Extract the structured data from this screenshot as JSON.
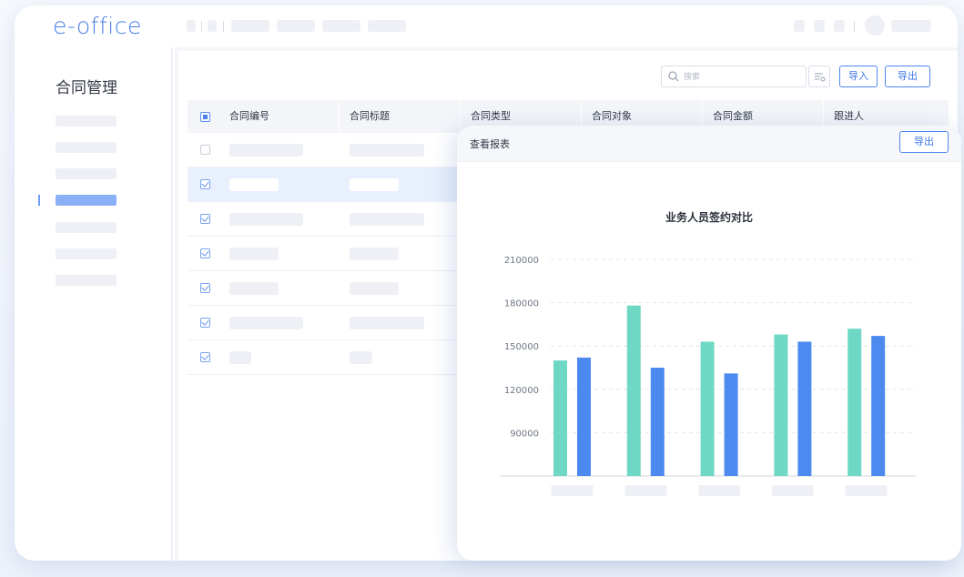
{
  "app": {
    "logo_text": "e-office"
  },
  "sidebar": {
    "title": "合同管理"
  },
  "toolbar": {
    "search_placeholder": "搜索",
    "import_label": "导入",
    "export_label": "导出"
  },
  "table": {
    "columns": [
      "合同编号",
      "合同标题",
      "合同类型",
      "合同对象",
      "合同金额",
      "跟进人"
    ],
    "rows": [
      {
        "checked": false,
        "selected": false
      },
      {
        "checked": true,
        "selected": true
      },
      {
        "checked": true,
        "selected": false
      },
      {
        "checked": true,
        "selected": false
      },
      {
        "checked": true,
        "selected": false
      },
      {
        "checked": true,
        "selected": false
      },
      {
        "checked": true,
        "selected": false
      }
    ]
  },
  "report": {
    "panel_title": "查看报表",
    "export_label": "导出"
  },
  "chart_data": {
    "type": "bar",
    "title": "业务人员签约对比",
    "y_ticks": [
      "210000",
      "180000",
      "150000",
      "120000",
      "90000"
    ],
    "ylim": [
      60000,
      210000
    ],
    "grid": true,
    "categories": [
      "",
      "",
      "",
      "",
      ""
    ],
    "series": [
      {
        "color": "#6fd8c4",
        "values": [
          140000,
          178000,
          153000,
          158000,
          162000
        ]
      },
      {
        "color": "#4d8af0",
        "values": [
          142000,
          135000,
          131000,
          153000,
          157000
        ]
      }
    ]
  },
  "colors": {
    "accent": "#4a7fe6",
    "teal": "#6fd8c4",
    "blue": "#4d8af0"
  },
  "icons": {
    "search": "search-icon",
    "filter": "filter-icon"
  }
}
